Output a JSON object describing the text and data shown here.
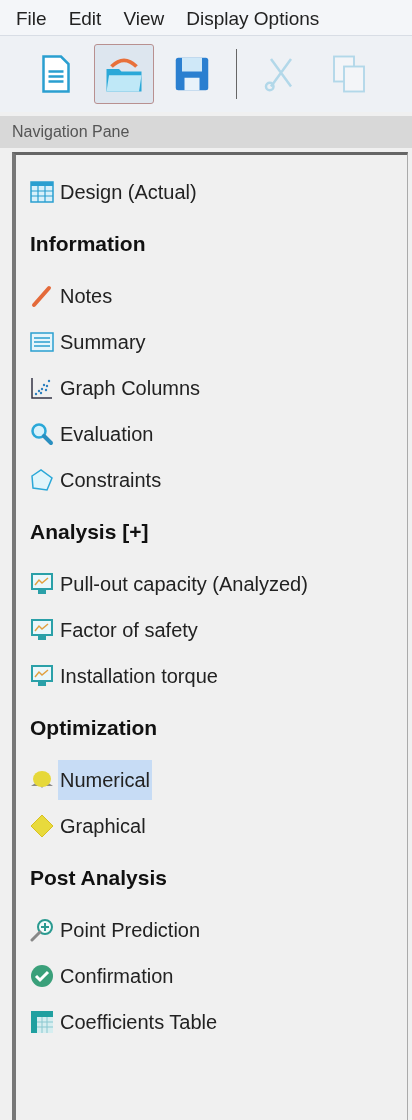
{
  "menu": [
    "File",
    "Edit",
    "View",
    "Display Options"
  ],
  "toolbar": [
    {
      "pressed": false,
      "disabled": false
    },
    {
      "pressed": true,
      "disabled": false
    },
    {
      "pressed": false,
      "disabled": false
    },
    {
      "pressed": false,
      "disabled": true
    },
    {
      "pressed": false,
      "disabled": true
    }
  ],
  "pane_title": "Navigation Pane",
  "tree": [
    {
      "kind": "item",
      "label": "Design (Actual)",
      "selected": false
    },
    {
      "kind": "heading",
      "label": "Information"
    },
    {
      "kind": "item",
      "label": "Notes",
      "selected": false
    },
    {
      "kind": "item",
      "label": "Summary",
      "selected": false
    },
    {
      "kind": "item",
      "label": "Graph Columns",
      "selected": false
    },
    {
      "kind": "item",
      "label": "Evaluation",
      "selected": false
    },
    {
      "kind": "item",
      "label": "Constraints",
      "selected": false
    },
    {
      "kind": "heading",
      "label": "Analysis [+]"
    },
    {
      "kind": "item",
      "label": "Pull-out capacity (Analyzed)",
      "selected": false
    },
    {
      "kind": "item",
      "label": "Factor of safety",
      "selected": false
    },
    {
      "kind": "item",
      "label": "Installation torque",
      "selected": false
    },
    {
      "kind": "heading",
      "label": "Optimization"
    },
    {
      "kind": "item",
      "label": "Numerical",
      "selected": true
    },
    {
      "kind": "item",
      "label": "Graphical",
      "selected": false
    },
    {
      "kind": "heading",
      "label": "Post Analysis"
    },
    {
      "kind": "item",
      "label": "Point Prediction",
      "selected": false
    },
    {
      "kind": "item",
      "label": "Confirmation",
      "selected": false
    },
    {
      "kind": "item",
      "label": "Coefficients Table",
      "selected": false
    }
  ]
}
